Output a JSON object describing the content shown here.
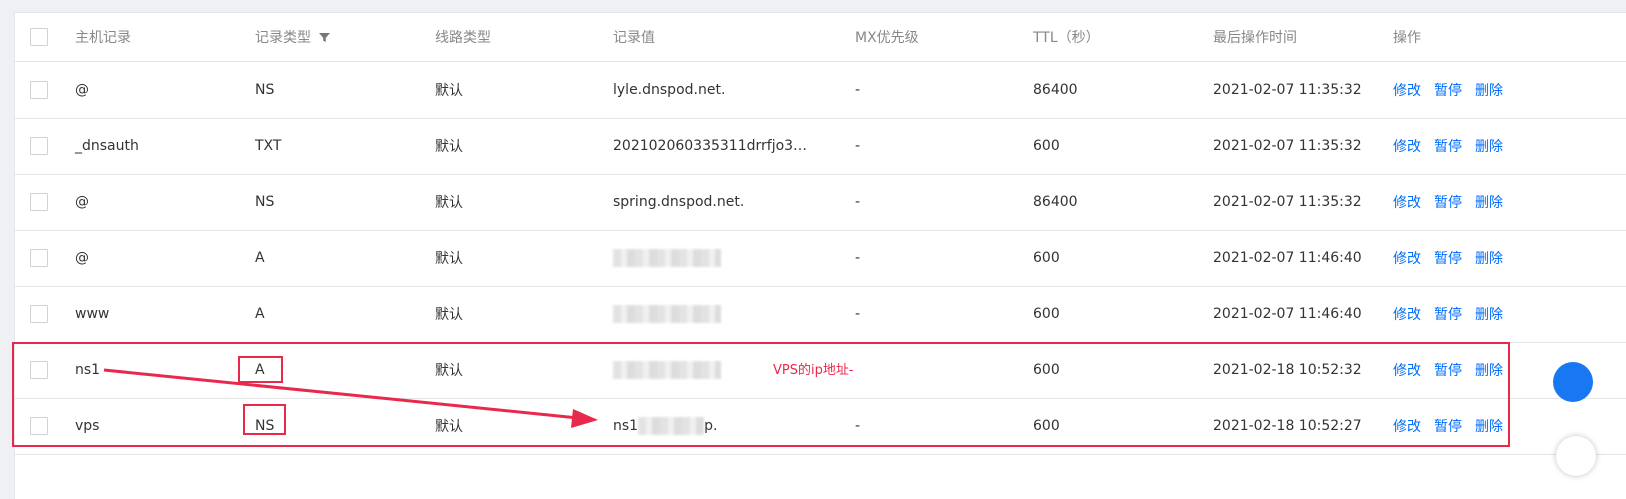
{
  "columns": {
    "host": "主机记录",
    "type": "记录类型",
    "line": "线路类型",
    "value": "记录值",
    "mx": "MX优先级",
    "ttl": "TTL（秒）",
    "time": "最后操作时间",
    "ops": "操作"
  },
  "actions": {
    "edit": "修改",
    "pause": "暂停",
    "delete": "删除"
  },
  "rows": [
    {
      "host": "@",
      "type": "NS",
      "line": "默认",
      "value": "lyle.dnspod.net.",
      "mx": "-",
      "ttl": "86400",
      "time": "2021-02-07 11:35:32"
    },
    {
      "host": "_dnsauth",
      "type": "TXT",
      "line": "默认",
      "value": "202102060335311drrfjo3…",
      "mx": "-",
      "ttl": "600",
      "time": "2021-02-07 11:35:32"
    },
    {
      "host": "@",
      "type": "NS",
      "line": "默认",
      "value": "spring.dnspod.net.",
      "mx": "-",
      "ttl": "86400",
      "time": "2021-02-07 11:35:32"
    },
    {
      "host": "@",
      "type": "A",
      "line": "默认",
      "value": "",
      "mx": "-",
      "ttl": "600",
      "time": "2021-02-07 11:46:40"
    },
    {
      "host": "www",
      "type": "A",
      "line": "默认",
      "value": "",
      "mx": "-",
      "ttl": "600",
      "time": "2021-02-07 11:46:40"
    },
    {
      "host": "ns1",
      "type": "A",
      "line": "默认",
      "value": "",
      "mx": "",
      "ttl": "600",
      "time": "2021-02-18 10:52:32"
    },
    {
      "host": "vps",
      "type": "NS",
      "line": "默认",
      "value_prefix": "ns1",
      "value_suffix": "p.",
      "mx": "-",
      "ttl": "600",
      "time": "2021-02-18 10:52:27"
    }
  ],
  "annotation": {
    "text": "VPS的ip地址-"
  },
  "colors": {
    "link": "#006eff",
    "annotation": "#e8294b"
  }
}
